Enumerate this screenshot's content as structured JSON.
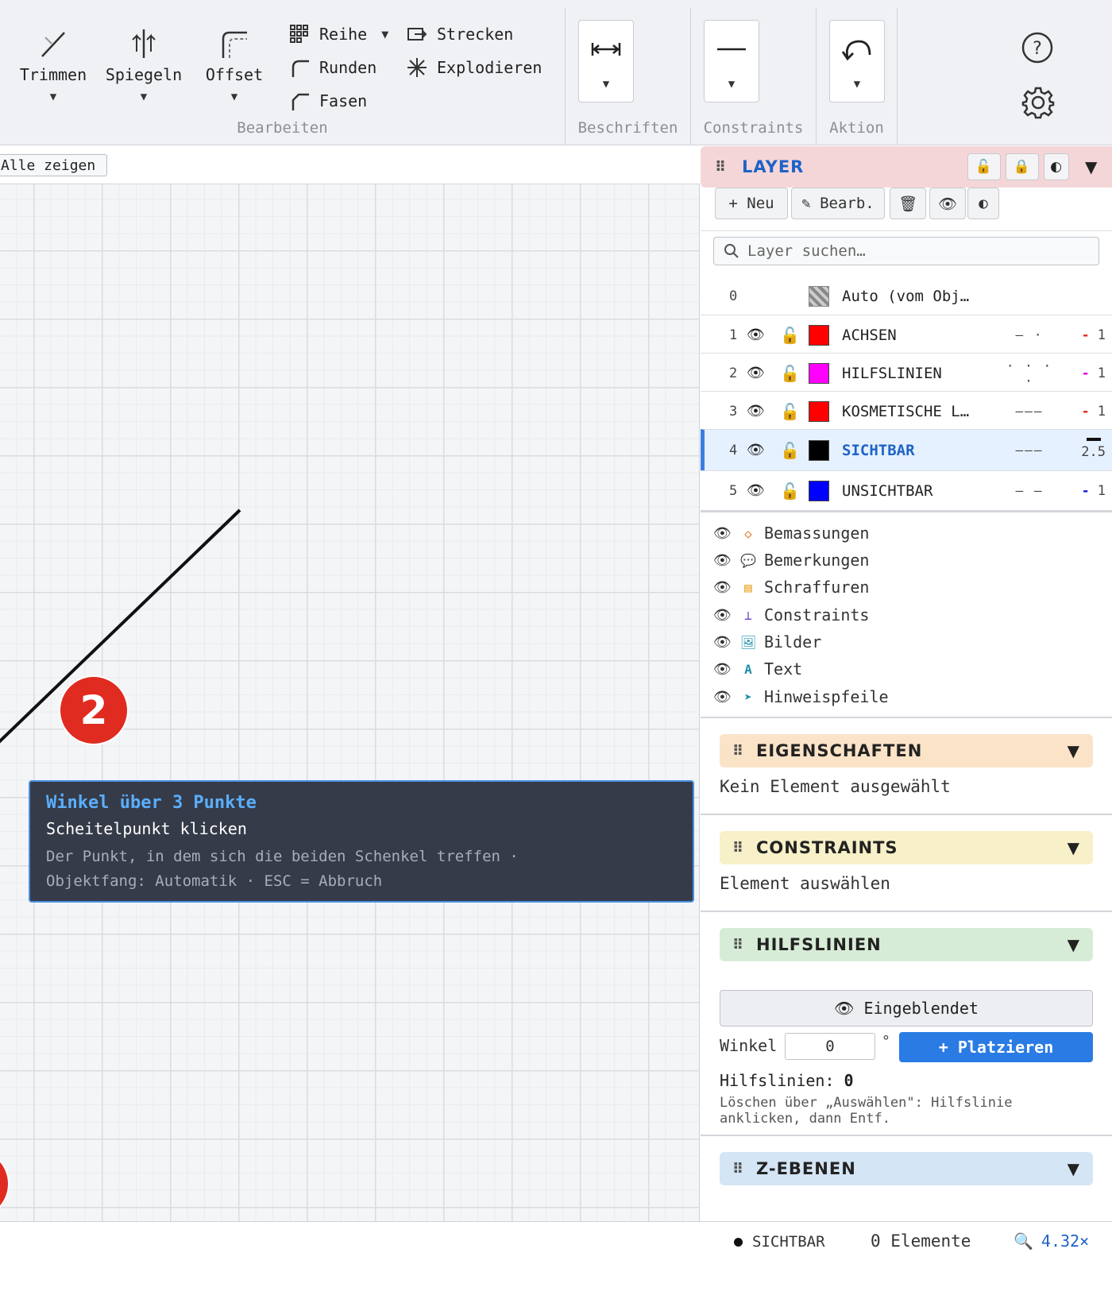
{
  "ribbon": {
    "tools": {
      "trimmen": "Trimmen",
      "spiegeln": "Spiegeln",
      "offset": "Offset",
      "reihe": "Reihe",
      "runden": "Runden",
      "fasen": "Fasen",
      "strecken": "Strecken",
      "explodieren": "Explodieren"
    },
    "groups": {
      "bearbeiten": "Bearbeiten",
      "beschriften": "Beschriften",
      "constraints": "Constraints",
      "aktion": "Aktion"
    },
    "icons": [
      "trim-icon",
      "mirror-icon",
      "offset-icon",
      "array-icon",
      "fillet-icon",
      "chamfer-icon",
      "stretch-icon",
      "explode-icon",
      "dimension-icon",
      "line-constraint-icon",
      "undo-icon",
      "help-icon",
      "gear-icon"
    ]
  },
  "canvas": {
    "show_all": "Alle zeigen",
    "badge_2": "2",
    "tooltip": {
      "title": "Winkel über 3 Punkte",
      "instruction": "Scheitelpunkt klicken",
      "detail_1": "Der Punkt, in dem sich die beiden Schenkel treffen ·",
      "detail_2": "Objektfang: Automatik · ESC = Abbruch"
    }
  },
  "panel": {
    "layer": {
      "title": "LAYER",
      "btn_new": "+ Neu",
      "btn_edit": "✎ Bearb.",
      "search_placeholder": "Layer suchen…",
      "rows": [
        {
          "num": "0",
          "name": "Auto (vom Obj…",
          "color": "#999999",
          "style": "",
          "weight": ""
        },
        {
          "num": "1",
          "name": "ACHSEN",
          "color": "#ff0000",
          "style": "— ·",
          "weight": "1"
        },
        {
          "num": "2",
          "name": "HILFSLINIEN",
          "color": "#ff00ff",
          "style": "· · · ·",
          "weight": "1"
        },
        {
          "num": "3",
          "name": "KOSMETISCHE L…",
          "color": "#ff0000",
          "style": "———",
          "weight": "1"
        },
        {
          "num": "4",
          "name": "SICHTBAR",
          "color": "#000000",
          "style": "———",
          "weight": "2.5"
        },
        {
          "num": "5",
          "name": "UNSICHTBAR",
          "color": "#0000ff",
          "style": "— —",
          "weight": "1"
        }
      ],
      "active_row": "4"
    },
    "visibility": [
      {
        "label": "Bemassungen",
        "icon": "◇",
        "color": "#e8761c"
      },
      {
        "label": "Bemerkungen",
        "icon": "💬",
        "color": "#333333"
      },
      {
        "label": "Schraffuren",
        "icon": "▤",
        "color": "#e8a11c"
      },
      {
        "label": "Constraints",
        "icon": "⊥",
        "color": "#6b46c1"
      },
      {
        "label": "Bilder",
        "icon": "🖼",
        "color": "#1c8fa8"
      },
      {
        "label": "Text",
        "icon": "A",
        "color": "#1c8fa8"
      },
      {
        "label": "Hinweispfeile",
        "icon": "➤",
        "color": "#1c8fa8"
      }
    ],
    "eigenschaften": {
      "title": "EIGENSCHAFTEN",
      "text": "Kein Element ausgewählt"
    },
    "constraints": {
      "title": "CONSTRAINTS",
      "text": "Element auswählen"
    },
    "hilfslinien": {
      "title": "HILFSLINIEN",
      "toggle": "Eingeblendet",
      "winkel_label": "Winkel",
      "winkel_value": "0",
      "winkel_unit": "°",
      "place_btn": "+ Platzieren",
      "count_label": "Hilfslinien:",
      "count_value": "0",
      "note": "Löschen über „Auswählen\": Hilfslinie anklicken, dann Entf."
    },
    "z_ebenen": {
      "title": "Z-EBENEN"
    }
  },
  "status": {
    "layer": "SICHTBAR",
    "count": "0 Elemente",
    "zoom": "4.32×"
  },
  "colors": {
    "accent": "#2a7be4",
    "layer_head": "#f5d6d8",
    "eigenschaften_head": "#fbe3c8",
    "constraints_head": "#f7f0c8",
    "hilfslinien_head": "#d7ecd6",
    "z_ebenen_head": "#d4e5f5",
    "badge": "#e02b20"
  }
}
